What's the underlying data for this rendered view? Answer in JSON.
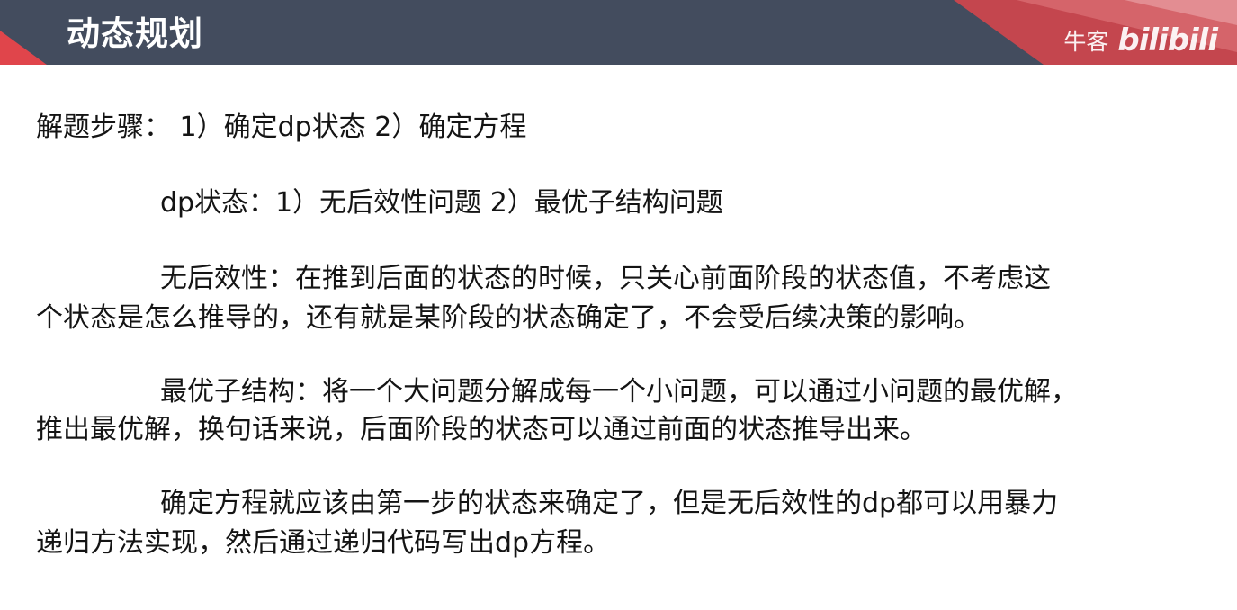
{
  "header": {
    "title": "动态规划",
    "watermark_brand": "牛客",
    "watermark_logo": "bilibili",
    "colors": {
      "bar": "#434c5e",
      "accent": "#e0454b"
    }
  },
  "content": {
    "steps": "解题步骤： 1）确定dp状态 2）确定方程",
    "dp_state": "dp状态：1）无后效性问题 2）最优子结构问题",
    "no_aftereffect": {
      "line1": "无后效性：在推到后面的状态的时候，只关心前面阶段的状态值，不考虑这",
      "line2": "个状态是怎么推导的，还有就是某阶段的状态确定了，不会受后续决策的影响。"
    },
    "optimal_substructure": {
      "line1": "最优子结构：将一个大问题分解成每一个小问题，可以通过小问题的最优解，",
      "line2": "推出最优解，换句话来说，后面阶段的状态可以通过前面的状态推导出来。"
    },
    "equation": {
      "line1": "确定方程就应该由第一步的状态来确定了，但是无后效性的dp都可以用暴力",
      "line2": "递归方法实现，然后通过递归代码写出dp方程。"
    }
  }
}
